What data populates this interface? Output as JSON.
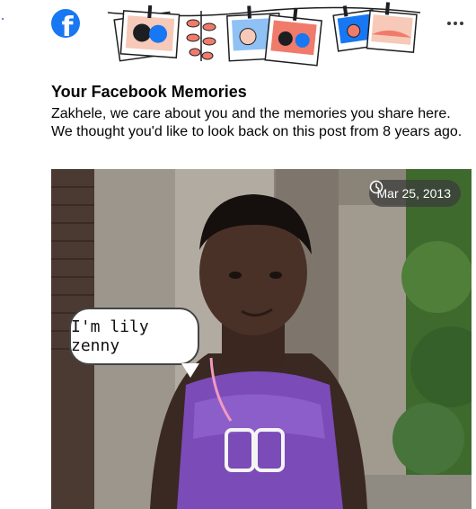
{
  "header": {
    "logo_icon": "facebook-logo-icon",
    "banner_icon": "hanging-photos-illustration",
    "more_icon": "more-options-icon",
    "brand_color": "#1877f2"
  },
  "memory": {
    "title": "Your Facebook Memories",
    "message": "Zakhele, we care about you and the memories you share here. We thought you'd like to look back on this post from 8 years ago."
  },
  "post": {
    "date": "Mar 25, 2013",
    "date_icon": "clock-icon",
    "photo_caption_text": "I'm lily zenny"
  }
}
